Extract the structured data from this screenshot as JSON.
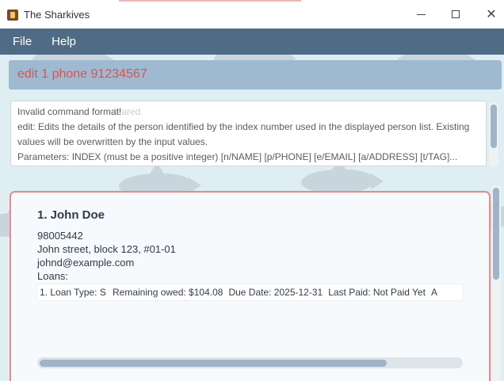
{
  "window": {
    "title": "The Sharkives"
  },
  "menu": {
    "items": [
      "File",
      "Help"
    ]
  },
  "command": {
    "value": "edit 1 phone 91234567"
  },
  "result": {
    "ghost_text": "leared.",
    "lines": [
      "Invalid command format!",
      "edit: Edits the details of the person identified by the index number used in the displayed person list. Existing",
      "values will be overwritten by the input values.",
      "Parameters: INDEX (must be a positive integer) [n/NAME] [p/PHONE] [e/EMAIL] [a/ADDRESS] [t/TAG]..."
    ]
  },
  "person": {
    "index_name": "1.  John Doe",
    "phone": "98005442",
    "address": "John street, block 123, #01-01",
    "email": "johnd@example.com",
    "loans_label": "Loans:",
    "loan": {
      "type": "1. Loan Type: S",
      "remaining": "Remaining owed: $104.08",
      "due": "Due Date: 2025-12-31",
      "last_paid": "Last Paid: Not Paid Yet",
      "overflow": "A"
    }
  },
  "scroll": {
    "result_position_fraction": 0.0,
    "card_horizontal_position_fraction": 0.0
  }
}
